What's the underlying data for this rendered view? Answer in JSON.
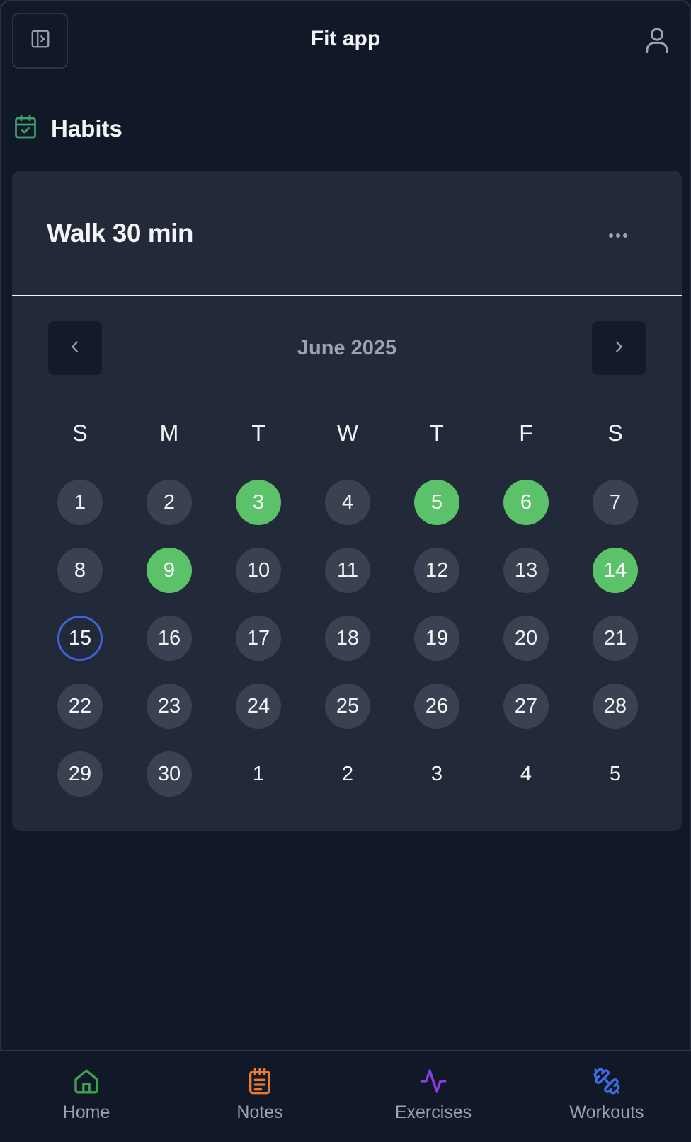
{
  "header": {
    "title": "Fit app",
    "sidebar_toggle_icon": "sidebar-toggle-icon",
    "user_icon": "user-icon"
  },
  "section": {
    "title": "Habits",
    "icon": "calendar-check-icon",
    "icon_color": "#3fa36b"
  },
  "habit": {
    "name": "Walk 30 min",
    "menu_icon": "more-horizontal-icon"
  },
  "calendar": {
    "month_label": "June 2025",
    "weekdays": [
      "S",
      "M",
      "T",
      "W",
      "T",
      "F",
      "S"
    ],
    "weeks": [
      [
        {
          "label": "1",
          "state": "normal"
        },
        {
          "label": "2",
          "state": "normal"
        },
        {
          "label": "3",
          "state": "done"
        },
        {
          "label": "4",
          "state": "normal"
        },
        {
          "label": "5",
          "state": "done"
        },
        {
          "label": "6",
          "state": "done"
        },
        {
          "label": "7",
          "state": "normal"
        }
      ],
      [
        {
          "label": "8",
          "state": "normal"
        },
        {
          "label": "9",
          "state": "done"
        },
        {
          "label": "10",
          "state": "normal"
        },
        {
          "label": "11",
          "state": "normal"
        },
        {
          "label": "12",
          "state": "normal"
        },
        {
          "label": "13",
          "state": "normal"
        },
        {
          "label": "14",
          "state": "done"
        }
      ],
      [
        {
          "label": "15",
          "state": "today"
        },
        {
          "label": "16",
          "state": "normal"
        },
        {
          "label": "17",
          "state": "normal"
        },
        {
          "label": "18",
          "state": "normal"
        },
        {
          "label": "19",
          "state": "normal"
        },
        {
          "label": "20",
          "state": "normal"
        },
        {
          "label": "21",
          "state": "normal"
        }
      ],
      [
        {
          "label": "22",
          "state": "normal"
        },
        {
          "label": "23",
          "state": "normal"
        },
        {
          "label": "24",
          "state": "normal"
        },
        {
          "label": "25",
          "state": "normal"
        },
        {
          "label": "26",
          "state": "normal"
        },
        {
          "label": "27",
          "state": "normal"
        },
        {
          "label": "28",
          "state": "normal"
        }
      ],
      [
        {
          "label": "29",
          "state": "normal"
        },
        {
          "label": "30",
          "state": "normal"
        },
        {
          "label": "1",
          "state": "outside"
        },
        {
          "label": "2",
          "state": "outside"
        },
        {
          "label": "3",
          "state": "outside"
        },
        {
          "label": "4",
          "state": "outside"
        },
        {
          "label": "5",
          "state": "outside"
        }
      ]
    ],
    "colors": {
      "done": "#5cc26a",
      "today_ring": "#3e64d8",
      "normal": "#3a4150"
    }
  },
  "bottom_nav": [
    {
      "label": "Home",
      "icon": "home-icon",
      "color": "#3fa34d"
    },
    {
      "label": "Notes",
      "icon": "clipboard-icon",
      "color": "#f07a2c"
    },
    {
      "label": "Exercises",
      "icon": "activity-icon",
      "color": "#8a3de6"
    },
    {
      "label": "Workouts",
      "icon": "dumbbell-icon",
      "color": "#3b6fe0"
    }
  ]
}
